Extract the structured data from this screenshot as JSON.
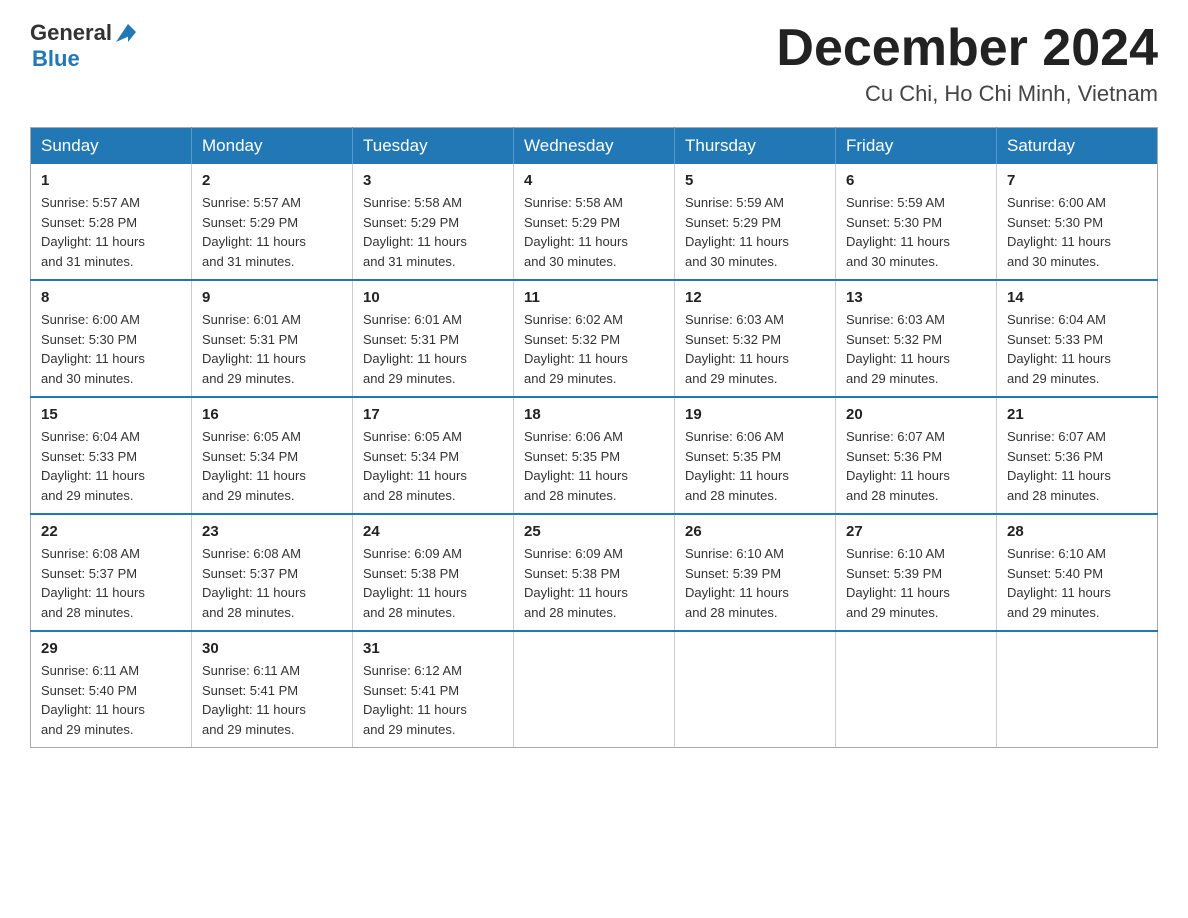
{
  "header": {
    "logo_general": "General",
    "logo_blue": "Blue",
    "month_title": "December 2024",
    "location": "Cu Chi, Ho Chi Minh, Vietnam"
  },
  "weekdays": [
    "Sunday",
    "Monday",
    "Tuesday",
    "Wednesday",
    "Thursday",
    "Friday",
    "Saturday"
  ],
  "weeks": [
    [
      {
        "day": "1",
        "sunrise": "5:57 AM",
        "sunset": "5:28 PM",
        "daylight": "11 hours and 31 minutes."
      },
      {
        "day": "2",
        "sunrise": "5:57 AM",
        "sunset": "5:29 PM",
        "daylight": "11 hours and 31 minutes."
      },
      {
        "day": "3",
        "sunrise": "5:58 AM",
        "sunset": "5:29 PM",
        "daylight": "11 hours and 31 minutes."
      },
      {
        "day": "4",
        "sunrise": "5:58 AM",
        "sunset": "5:29 PM",
        "daylight": "11 hours and 30 minutes."
      },
      {
        "day": "5",
        "sunrise": "5:59 AM",
        "sunset": "5:29 PM",
        "daylight": "11 hours and 30 minutes."
      },
      {
        "day": "6",
        "sunrise": "5:59 AM",
        "sunset": "5:30 PM",
        "daylight": "11 hours and 30 minutes."
      },
      {
        "day": "7",
        "sunrise": "6:00 AM",
        "sunset": "5:30 PM",
        "daylight": "11 hours and 30 minutes."
      }
    ],
    [
      {
        "day": "8",
        "sunrise": "6:00 AM",
        "sunset": "5:30 PM",
        "daylight": "11 hours and 30 minutes."
      },
      {
        "day": "9",
        "sunrise": "6:01 AM",
        "sunset": "5:31 PM",
        "daylight": "11 hours and 29 minutes."
      },
      {
        "day": "10",
        "sunrise": "6:01 AM",
        "sunset": "5:31 PM",
        "daylight": "11 hours and 29 minutes."
      },
      {
        "day": "11",
        "sunrise": "6:02 AM",
        "sunset": "5:32 PM",
        "daylight": "11 hours and 29 minutes."
      },
      {
        "day": "12",
        "sunrise": "6:03 AM",
        "sunset": "5:32 PM",
        "daylight": "11 hours and 29 minutes."
      },
      {
        "day": "13",
        "sunrise": "6:03 AM",
        "sunset": "5:32 PM",
        "daylight": "11 hours and 29 minutes."
      },
      {
        "day": "14",
        "sunrise": "6:04 AM",
        "sunset": "5:33 PM",
        "daylight": "11 hours and 29 minutes."
      }
    ],
    [
      {
        "day": "15",
        "sunrise": "6:04 AM",
        "sunset": "5:33 PM",
        "daylight": "11 hours and 29 minutes."
      },
      {
        "day": "16",
        "sunrise": "6:05 AM",
        "sunset": "5:34 PM",
        "daylight": "11 hours and 29 minutes."
      },
      {
        "day": "17",
        "sunrise": "6:05 AM",
        "sunset": "5:34 PM",
        "daylight": "11 hours and 28 minutes."
      },
      {
        "day": "18",
        "sunrise": "6:06 AM",
        "sunset": "5:35 PM",
        "daylight": "11 hours and 28 minutes."
      },
      {
        "day": "19",
        "sunrise": "6:06 AM",
        "sunset": "5:35 PM",
        "daylight": "11 hours and 28 minutes."
      },
      {
        "day": "20",
        "sunrise": "6:07 AM",
        "sunset": "5:36 PM",
        "daylight": "11 hours and 28 minutes."
      },
      {
        "day": "21",
        "sunrise": "6:07 AM",
        "sunset": "5:36 PM",
        "daylight": "11 hours and 28 minutes."
      }
    ],
    [
      {
        "day": "22",
        "sunrise": "6:08 AM",
        "sunset": "5:37 PM",
        "daylight": "11 hours and 28 minutes."
      },
      {
        "day": "23",
        "sunrise": "6:08 AM",
        "sunset": "5:37 PM",
        "daylight": "11 hours and 28 minutes."
      },
      {
        "day": "24",
        "sunrise": "6:09 AM",
        "sunset": "5:38 PM",
        "daylight": "11 hours and 28 minutes."
      },
      {
        "day": "25",
        "sunrise": "6:09 AM",
        "sunset": "5:38 PM",
        "daylight": "11 hours and 28 minutes."
      },
      {
        "day": "26",
        "sunrise": "6:10 AM",
        "sunset": "5:39 PM",
        "daylight": "11 hours and 28 minutes."
      },
      {
        "day": "27",
        "sunrise": "6:10 AM",
        "sunset": "5:39 PM",
        "daylight": "11 hours and 29 minutes."
      },
      {
        "day": "28",
        "sunrise": "6:10 AM",
        "sunset": "5:40 PM",
        "daylight": "11 hours and 29 minutes."
      }
    ],
    [
      {
        "day": "29",
        "sunrise": "6:11 AM",
        "sunset": "5:40 PM",
        "daylight": "11 hours and 29 minutes."
      },
      {
        "day": "30",
        "sunrise": "6:11 AM",
        "sunset": "5:41 PM",
        "daylight": "11 hours and 29 minutes."
      },
      {
        "day": "31",
        "sunrise": "6:12 AM",
        "sunset": "5:41 PM",
        "daylight": "11 hours and 29 minutes."
      },
      null,
      null,
      null,
      null
    ]
  ],
  "labels": {
    "sunrise": "Sunrise:",
    "sunset": "Sunset:",
    "daylight": "Daylight:"
  }
}
